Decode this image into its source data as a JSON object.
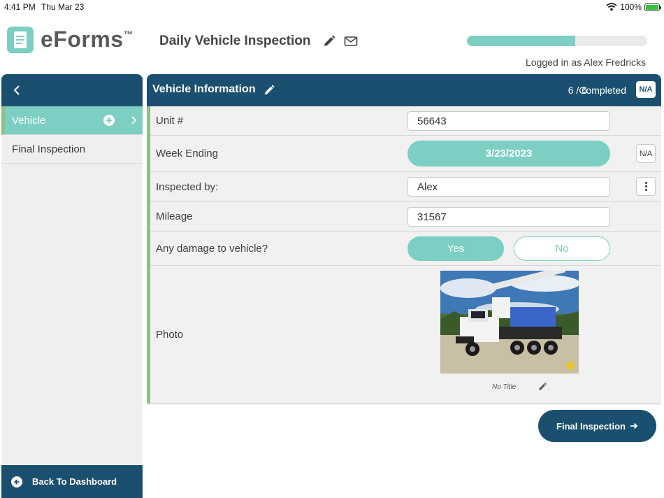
{
  "status_bar": {
    "time": "4:41 PM",
    "date": "Thu Mar 23",
    "battery": "100%"
  },
  "header": {
    "app_name": "eForms",
    "trademark": "™",
    "form_title": "Daily Vehicle Inspection",
    "progress": 0.6,
    "logged_in": "Logged in as Alex Fredricks"
  },
  "sidebar": {
    "items": [
      {
        "label": "Vehicle",
        "active": true
      },
      {
        "label": "Final Inspection",
        "active": false
      }
    ],
    "footer_label": "Back To Dashboard"
  },
  "section": {
    "title": "Vehicle Information",
    "count": "6 / 6",
    "status": "Completed",
    "na_label": "N/A"
  },
  "fields": {
    "unit": {
      "label": "Unit #",
      "value": "56643"
    },
    "week_ending": {
      "label": "Week Ending",
      "value": "3/23/2023",
      "na_label": "N/A"
    },
    "inspected_by": {
      "label": "Inspected by:",
      "value": "Alex"
    },
    "mileage": {
      "label": "Mileage",
      "value": "31567"
    },
    "damage": {
      "label": "Any damage to vehicle?",
      "yes": "Yes",
      "no": "No",
      "selected": "Yes"
    },
    "photo": {
      "label": "Photo",
      "caption": "No Title"
    }
  },
  "next_button": {
    "label": "Final Inspection"
  },
  "colors": {
    "navy": "#1b4f6f",
    "teal": "#7ccfc2",
    "green_accent": "#8fbf85"
  },
  "icons": [
    "wifi-icon",
    "battery-icon",
    "pencil-icon",
    "mail-icon",
    "chevron-left-icon",
    "plus-circle-icon",
    "chevron-right-icon",
    "arrow-left-circle-icon",
    "kebab-icon",
    "arrow-right-icon"
  ]
}
